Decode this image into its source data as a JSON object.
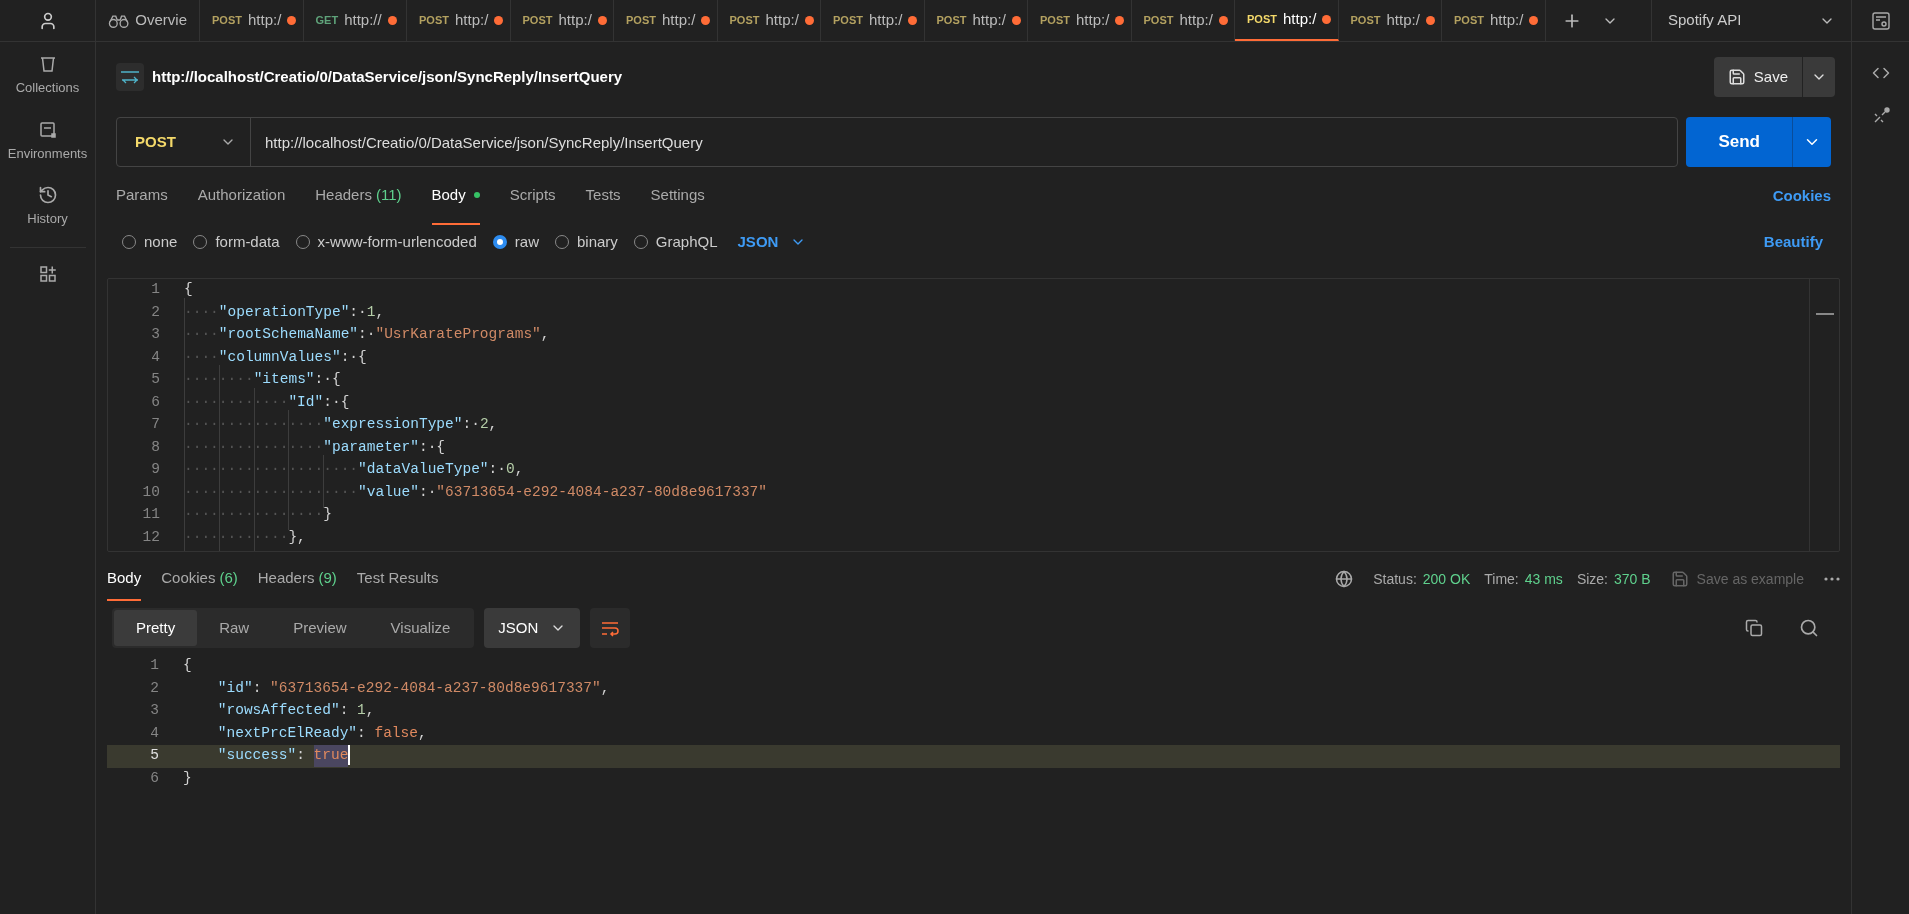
{
  "sidebar": {
    "items": [
      {
        "kind": "collections",
        "label": "Collections"
      },
      {
        "kind": "environments",
        "label": "Environments"
      },
      {
        "kind": "history",
        "label": "History"
      }
    ]
  },
  "tabs": [
    {
      "kind": "overview",
      "label": "Overvie",
      "selected": false,
      "unsaved": false
    },
    {
      "kind": "request",
      "method": "POST",
      "label": "http:/",
      "selected": false,
      "unsaved": true
    },
    {
      "kind": "request",
      "method": "GET",
      "label": "http://",
      "selected": false,
      "unsaved": true
    },
    {
      "kind": "request",
      "method": "POST",
      "label": "http:/",
      "selected": false,
      "unsaved": true
    },
    {
      "kind": "request",
      "method": "POST",
      "label": "http:/",
      "selected": false,
      "unsaved": true
    },
    {
      "kind": "request",
      "method": "POST",
      "label": "http:/",
      "selected": false,
      "unsaved": true
    },
    {
      "kind": "request",
      "method": "POST",
      "label": "http:/",
      "selected": false,
      "unsaved": true
    },
    {
      "kind": "request",
      "method": "POST",
      "label": "http:/",
      "selected": false,
      "unsaved": true
    },
    {
      "kind": "request",
      "method": "POST",
      "label": "http:/",
      "selected": false,
      "unsaved": true
    },
    {
      "kind": "request",
      "method": "POST",
      "label": "http:/",
      "selected": false,
      "unsaved": true
    },
    {
      "kind": "request",
      "method": "POST",
      "label": "http:/",
      "selected": false,
      "unsaved": true
    },
    {
      "kind": "request",
      "method": "POST",
      "label": "http:/",
      "selected": true,
      "unsaved": true
    },
    {
      "kind": "request",
      "method": "POST",
      "label": "http:/",
      "selected": false,
      "unsaved": true
    },
    {
      "kind": "request",
      "method": "POST",
      "label": "http:/",
      "selected": false,
      "unsaved": true
    }
  ],
  "workspace": "Spotify API",
  "request": {
    "title": "http://localhost/Creatio/0/DataService/json/SyncReply/InsertQuery",
    "save": "Save",
    "method": "POST",
    "url": "http://localhost/Creatio/0/DataService/json/SyncReply/InsertQuery",
    "send": "Send",
    "tabs": [
      {
        "label": "Params",
        "selected": false
      },
      {
        "label": "Authorization",
        "selected": false
      },
      {
        "label": "Headers",
        "count": "(11)",
        "selected": false
      },
      {
        "label": "Body",
        "selected": true,
        "has_content": true
      },
      {
        "label": "Scripts",
        "selected": false
      },
      {
        "label": "Tests",
        "selected": false
      },
      {
        "label": "Settings",
        "selected": false
      }
    ],
    "cookies": "Cookies",
    "body_types": [
      {
        "label": "none",
        "selected": false
      },
      {
        "label": "form-data",
        "selected": false
      },
      {
        "label": "x-www-form-urlencoded",
        "selected": false
      },
      {
        "label": "raw",
        "selected": true
      },
      {
        "label": "binary",
        "selected": false
      },
      {
        "label": "GraphQL",
        "selected": false
      }
    ],
    "format": "JSON",
    "beautify": "Beautify",
    "lines": [
      {
        "number": "1",
        "tokens": [
          {
            "kind": "punct",
            "text": "{"
          }
        ]
      },
      {
        "number": "2",
        "indent": "····",
        "tokens": [
          {
            "kind": "key",
            "text": "\"operationType\""
          },
          {
            "kind": "punct",
            "text": ":·"
          },
          {
            "kind": "number",
            "text": "1"
          },
          {
            "kind": "punct",
            "text": ","
          }
        ]
      },
      {
        "number": "3",
        "indent": "····",
        "tokens": [
          {
            "kind": "key",
            "text": "\"rootSchemaName\""
          },
          {
            "kind": "punct",
            "text": ":·"
          },
          {
            "kind": "string",
            "text": "\"UsrKaratePrograms\""
          },
          {
            "kind": "punct",
            "text": ","
          }
        ]
      },
      {
        "number": "4",
        "indent": "····",
        "tokens": [
          {
            "kind": "key",
            "text": "\"columnValues\""
          },
          {
            "kind": "punct",
            "text": ":·{"
          }
        ]
      },
      {
        "number": "5",
        "indent": "········",
        "tokens": [
          {
            "kind": "key",
            "text": "\"items\""
          },
          {
            "kind": "punct",
            "text": ":·{"
          }
        ]
      },
      {
        "number": "6",
        "indent": "············",
        "tokens": [
          {
            "kind": "key",
            "text": "\"Id\""
          },
          {
            "kind": "punct",
            "text": ":·{"
          }
        ]
      },
      {
        "number": "7",
        "indent": "················",
        "tokens": [
          {
            "kind": "key",
            "text": "\"expressionType\""
          },
          {
            "kind": "punct",
            "text": ":·"
          },
          {
            "kind": "number",
            "text": "2"
          },
          {
            "kind": "punct",
            "text": ","
          }
        ]
      },
      {
        "number": "8",
        "indent": "················",
        "tokens": [
          {
            "kind": "key",
            "text": "\"parameter\""
          },
          {
            "kind": "punct",
            "text": ":·{"
          }
        ]
      },
      {
        "number": "9",
        "indent": "····················",
        "tokens": [
          {
            "kind": "key",
            "text": "\"dataValueType\""
          },
          {
            "kind": "punct",
            "text": ":·"
          },
          {
            "kind": "number",
            "text": "0"
          },
          {
            "kind": "punct",
            "text": ","
          }
        ]
      },
      {
        "number": "10",
        "indent": "····················",
        "tokens": [
          {
            "kind": "key",
            "text": "\"value\""
          },
          {
            "kind": "punct",
            "text": ":·"
          },
          {
            "kind": "string",
            "text": "\"63713654-e292-4084-a237-80d8e9617337\""
          }
        ]
      },
      {
        "number": "11",
        "indent": "················",
        "tokens": [
          {
            "kind": "punct",
            "text": "}"
          }
        ]
      },
      {
        "number": "12",
        "indent": "············",
        "tokens": [
          {
            "kind": "punct",
            "text": "},"
          }
        ]
      }
    ]
  },
  "response": {
    "tabs": [
      {
        "label": "Body",
        "selected": true
      },
      {
        "label": "Cookies",
        "count": "(6)",
        "selected": false
      },
      {
        "label": "Headers",
        "count": "(9)",
        "selected": false
      },
      {
        "label": "Test Results",
        "selected": false
      }
    ],
    "status_label": "Status:",
    "status": "200 OK",
    "time_label": "Time:",
    "time": "43 ms",
    "size_label": "Size:",
    "size": "370 B",
    "save_example": {
      "label": "Save as example",
      "disabled": true
    },
    "views": [
      {
        "label": "Pretty",
        "selected": true
      },
      {
        "label": "Raw",
        "selected": false
      },
      {
        "label": "Preview",
        "selected": false
      },
      {
        "label": "Visualize",
        "selected": false
      }
    ],
    "format": "JSON",
    "lines": [
      {
        "number": "1",
        "current": false,
        "tokens": [
          {
            "kind": "punct",
            "text": "{",
            "selected": false
          }
        ]
      },
      {
        "number": "2",
        "current": false,
        "tokens": [
          {
            "kind": "key",
            "text": "    \"id\"",
            "selected": false
          },
          {
            "kind": "punct",
            "text": ": ",
            "selected": false
          },
          {
            "kind": "string",
            "text": "\"63713654-e292-4084-a237-80d8e9617337\"",
            "selected": false
          },
          {
            "kind": "punct",
            "text": ",",
            "selected": false
          }
        ]
      },
      {
        "number": "3",
        "current": false,
        "tokens": [
          {
            "kind": "key",
            "text": "    \"rowsAffected\"",
            "selected": false
          },
          {
            "kind": "punct",
            "text": ": ",
            "selected": false
          },
          {
            "kind": "number",
            "text": "1",
            "selected": false
          },
          {
            "kind": "punct",
            "text": ",",
            "selected": false
          }
        ]
      },
      {
        "number": "4",
        "current": false,
        "tokens": [
          {
            "kind": "key",
            "text": "    \"nextPrcElReady\"",
            "selected": false
          },
          {
            "kind": "punct",
            "text": ": ",
            "selected": false
          },
          {
            "kind": "boolean",
            "text": "false",
            "selected": false
          },
          {
            "kind": "punct",
            "text": ",",
            "selected": false
          }
        ]
      },
      {
        "number": "5",
        "current": true,
        "tokens": [
          {
            "kind": "key",
            "text": "    \"success\"",
            "selected": false
          },
          {
            "kind": "punct",
            "text": ": ",
            "selected": false
          },
          {
            "kind": "boolean",
            "text": "true",
            "selected": true
          }
        ]
      },
      {
        "number": "6",
        "current": false,
        "tokens": [
          {
            "kind": "punct",
            "text": "}",
            "selected": false
          }
        ]
      }
    ]
  }
}
